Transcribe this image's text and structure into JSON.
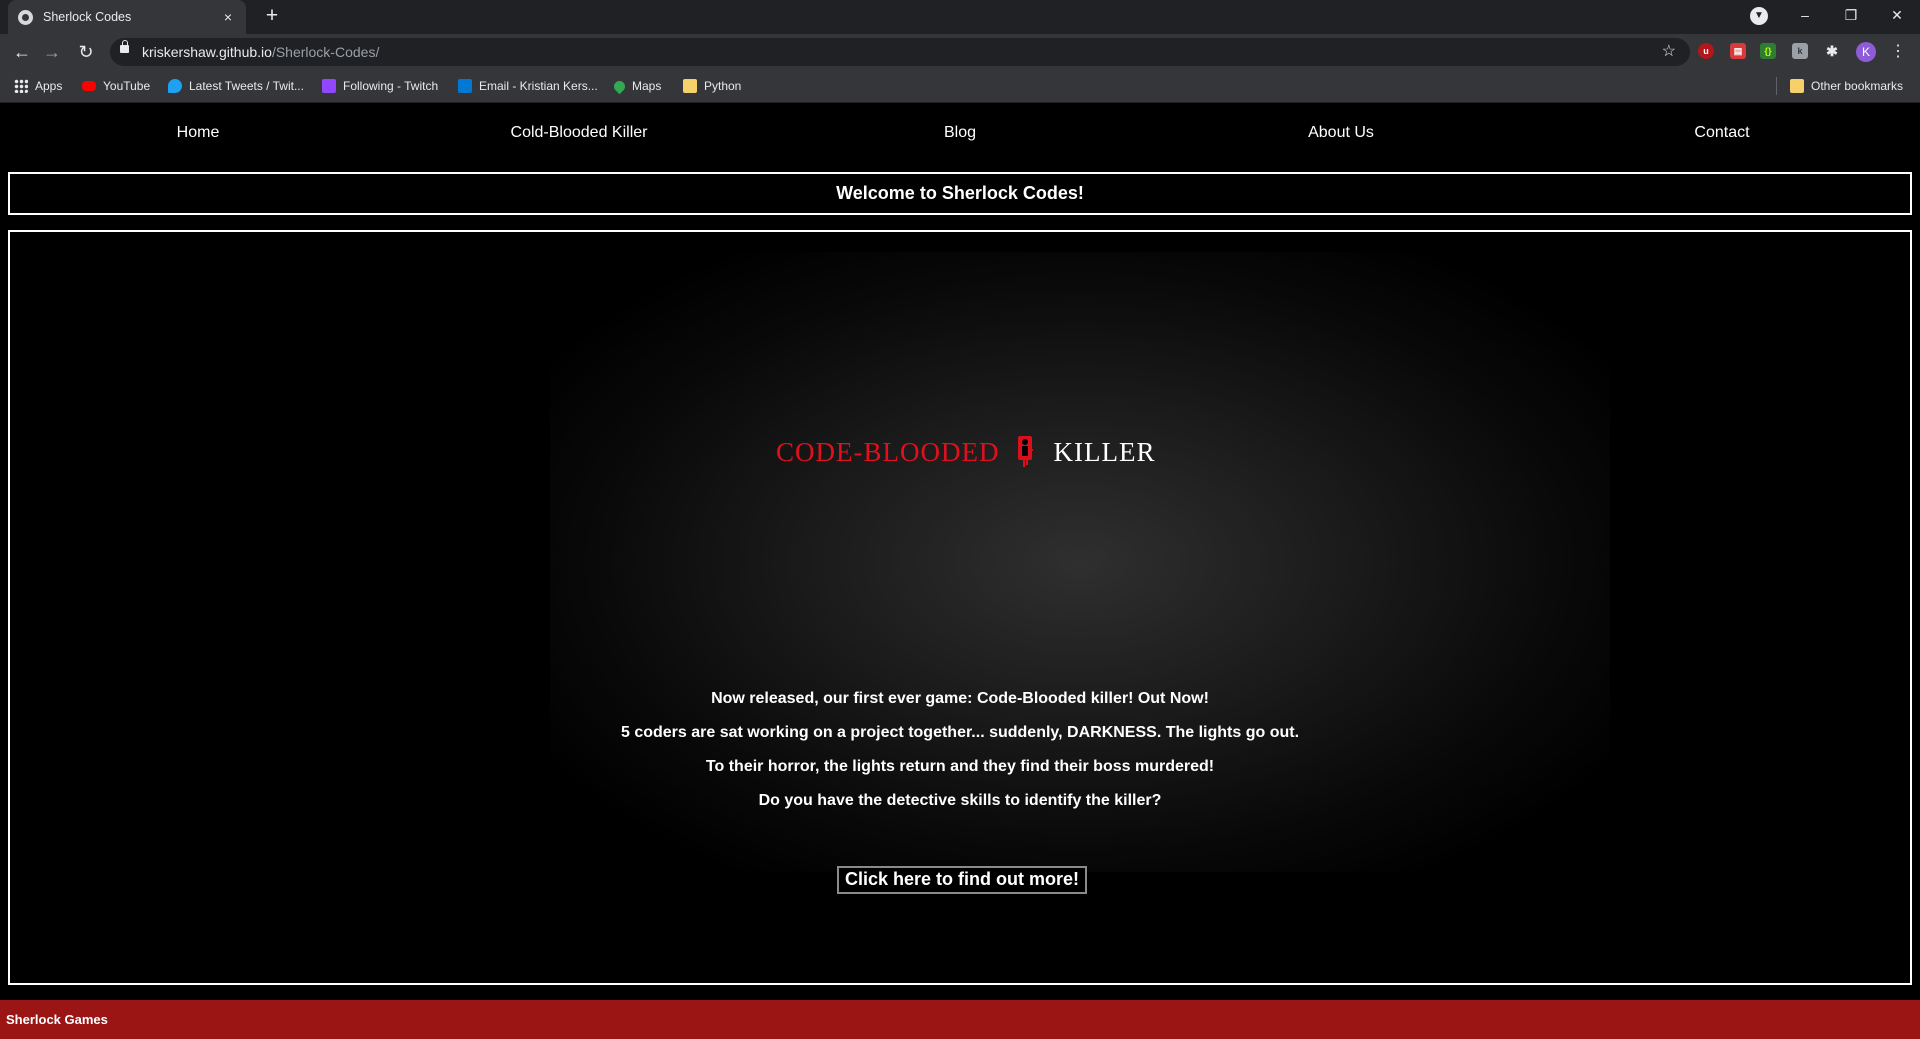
{
  "browser": {
    "tab_title": "Sherlock Codes",
    "tab_close": "×",
    "new_tab": "+",
    "url_host": "kriskershaw.github.io",
    "url_path": "/Sherlock-Codes/",
    "profile_initial": "K",
    "window_controls": {
      "minimize": "–",
      "restore": "❐",
      "close": "✕"
    },
    "bookmarks": [
      {
        "label": "Apps",
        "icon": "apps-grid-icon",
        "color": "#e8eaed"
      },
      {
        "label": "YouTube",
        "icon": "youtube-icon",
        "color": "#ff0000"
      },
      {
        "label": "Latest Tweets / Twit...",
        "icon": "twitter-icon",
        "color": "#1da1f2"
      },
      {
        "label": "Following - Twitch",
        "icon": "twitch-icon",
        "color": "#9146ff"
      },
      {
        "label": "Email - Kristian Kers...",
        "icon": "outlook-icon",
        "color": "#0078d4"
      },
      {
        "label": "Maps",
        "icon": "maps-pin-icon",
        "color": "#34a853"
      },
      {
        "label": "Python",
        "icon": "folder-icon",
        "color": "#f6d06a"
      }
    ],
    "other_bookmarks": "Other bookmarks"
  },
  "nav": {
    "items": [
      "Home",
      "Cold-Blooded Killer",
      "Blog",
      "About Us",
      "Contact"
    ]
  },
  "welcome": "Welcome to Sherlock Codes!",
  "hero": {
    "logo_left": "CODE-BLOODED",
    "logo_right": "KILLER",
    "logo_left_color": "#e0101e"
  },
  "intro": [
    "Now released, our first ever game: Code-Blooded killer! Out Now!",
    "5 coders are sat working on a project together... suddenly, DARKNESS. The lights go out.",
    "To their horror, the lights return and they find their boss murdered!",
    "Do you have the detective skills to identify the killer?"
  ],
  "cta_label": "Click here to find out more!",
  "footer": {
    "text": "Sherlock Games",
    "color": "#9c1515"
  }
}
